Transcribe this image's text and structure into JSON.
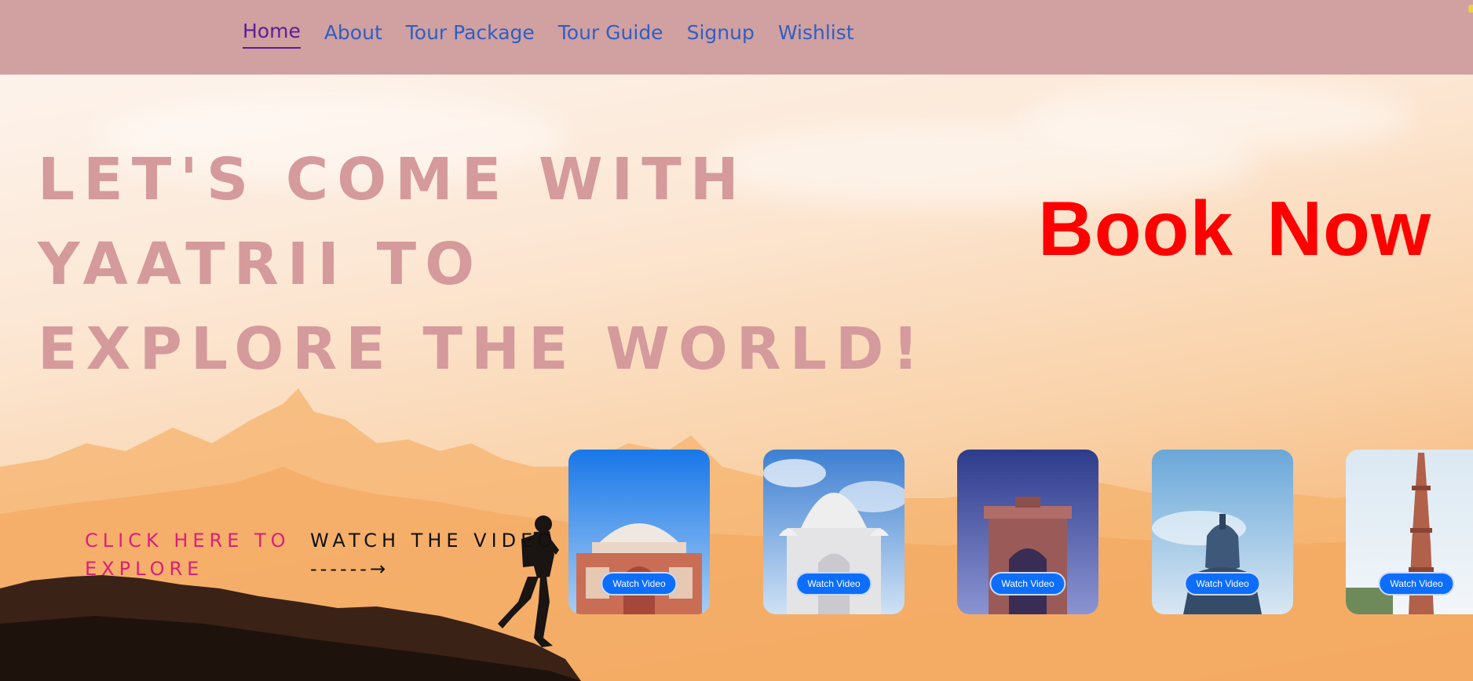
{
  "nav": {
    "items": [
      {
        "label": "Home",
        "active": true
      },
      {
        "label": "About"
      },
      {
        "label": "Tour Package"
      },
      {
        "label": "Tour Guide"
      },
      {
        "label": "Signup"
      },
      {
        "label": "Wishlist"
      }
    ],
    "background": "#d1a0a1",
    "link_color": "#2e5fc4",
    "active_color": "#5b1e93"
  },
  "hero": {
    "headline_lines": [
      "LET'S COME WITH",
      "YAATRII TO",
      "EXPLORE THE WORLD!"
    ],
    "headline_color": "#d49a9c",
    "book_now": "Book Now",
    "book_now_color": "#ff0000",
    "explore_line1": "CLICK HERE TO",
    "explore_line2": "EXPLORE",
    "explore_color": "#dc1f7a",
    "watch_line": "WATCH THE VIDEO",
    "watch_arrow": "------→"
  },
  "cards": [
    {
      "landmark": "humayun-tomb-icon",
      "button": "Watch Video"
    },
    {
      "landmark": "taj-mahal-icon",
      "button": "Watch Video"
    },
    {
      "landmark": "india-gate-icon",
      "button": "Watch Video"
    },
    {
      "landmark": "shiva-statue-icon",
      "button": "Watch Video"
    },
    {
      "landmark": "qutub-minar-icon",
      "button": "Watch Video"
    }
  ]
}
